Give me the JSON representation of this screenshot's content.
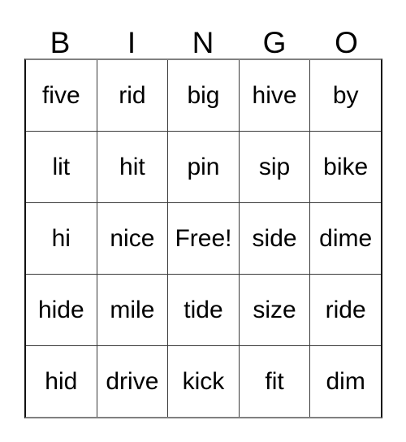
{
  "card": {
    "header": {
      "letters": [
        "B",
        "I",
        "N",
        "G",
        "O"
      ]
    },
    "grid": {
      "columns": 5,
      "rows": 5,
      "free_space": "Free!",
      "cells": [
        [
          "five",
          "rid",
          "big",
          "hive",
          "by"
        ],
        [
          "lit",
          "hit",
          "pin",
          "sip",
          "bike"
        ],
        [
          "hi",
          "nice",
          "Free!",
          "side",
          "dime"
        ],
        [
          "hide",
          "mile",
          "tide",
          "size",
          "ride"
        ],
        [
          "hid",
          "drive",
          "kick",
          "fit",
          "dim"
        ]
      ]
    },
    "colors": {
      "background": "#ffffff",
      "text": "#000000",
      "grid_line": "#3a3a3a",
      "outer_border": "#111111"
    }
  }
}
